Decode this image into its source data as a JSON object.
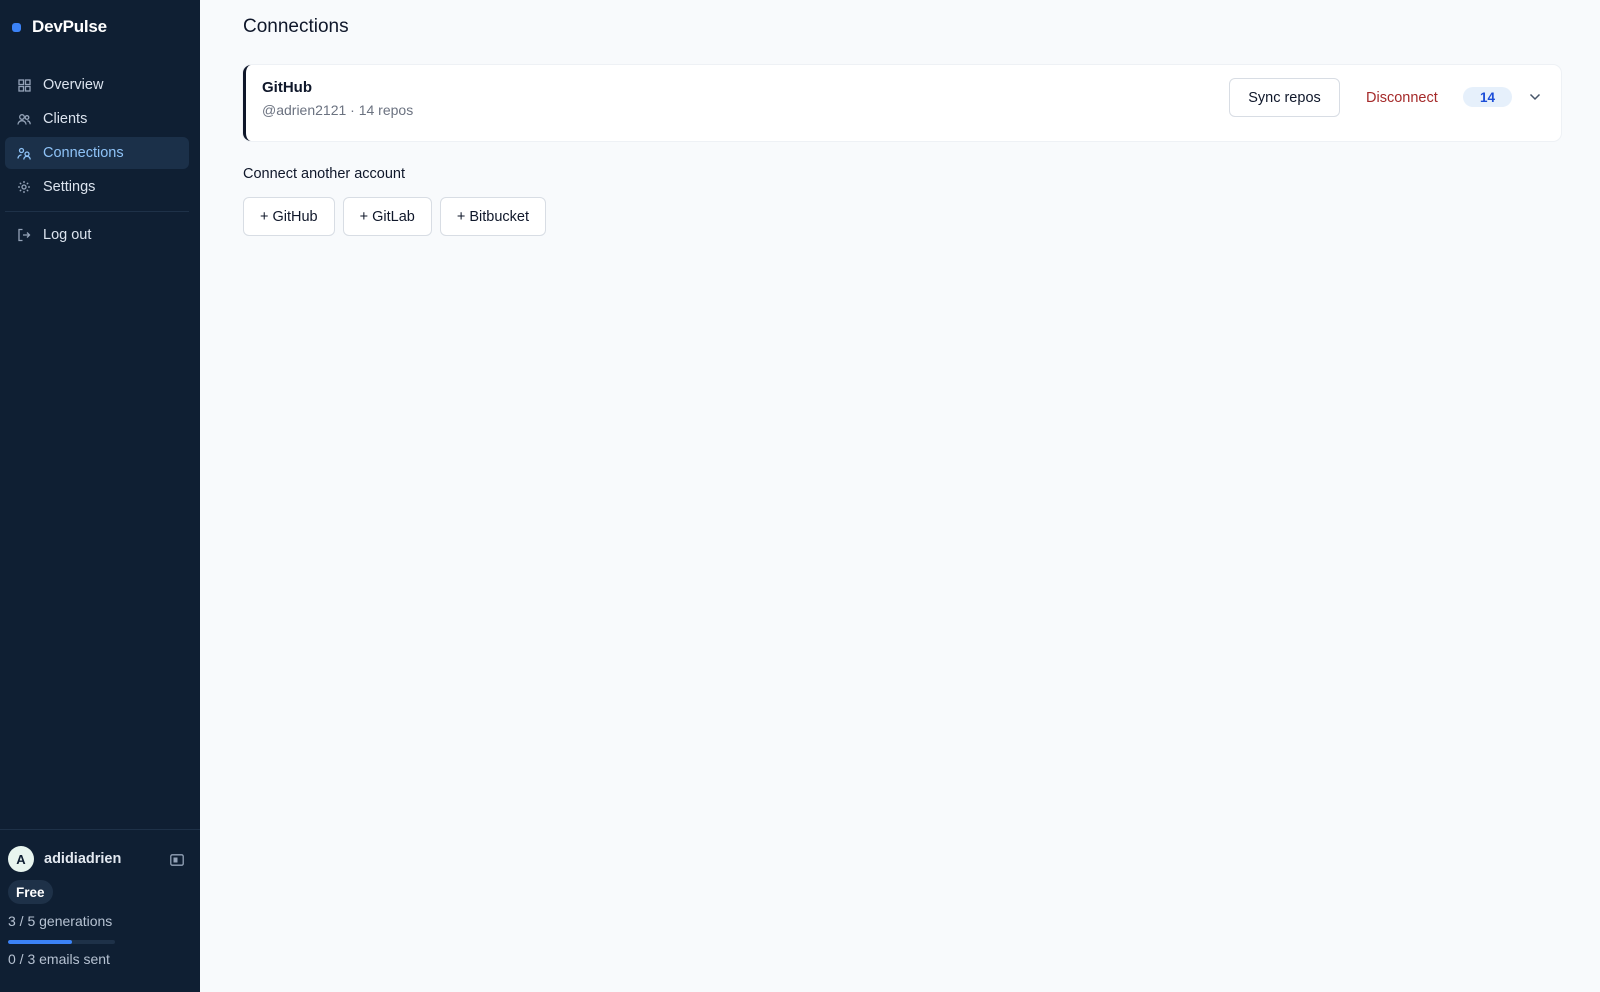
{
  "app": {
    "name": "DevPulse",
    "accent_color": "#3b82f6"
  },
  "sidebar": {
    "items": [
      {
        "label": "Overview",
        "icon": "grid-icon"
      },
      {
        "label": "Clients",
        "icon": "users-icon"
      },
      {
        "label": "Connections",
        "icon": "connections-icon",
        "active": true
      },
      {
        "label": "Settings",
        "icon": "gear-icon"
      }
    ],
    "logout_label": "Log out",
    "user": {
      "initial": "A",
      "name": "adidiadrien"
    },
    "plan": "Free",
    "usage": {
      "generations_text": "3 / 5 generations",
      "generations_used": 3,
      "generations_limit": 5,
      "emails_text": "0 / 3 emails sent"
    }
  },
  "main": {
    "title": "Connections",
    "connection": {
      "provider": "GitHub",
      "meta": "@adrien2121 · 14 repos",
      "sync_label": "Sync repos",
      "disconnect_label": "Disconnect",
      "count": "14",
      "disconnect_color": "#a52a2a"
    },
    "connect_another_label": "Connect another account",
    "providers": [
      "+ GitHub",
      "+ GitLab",
      "+ Bitbucket"
    ]
  }
}
